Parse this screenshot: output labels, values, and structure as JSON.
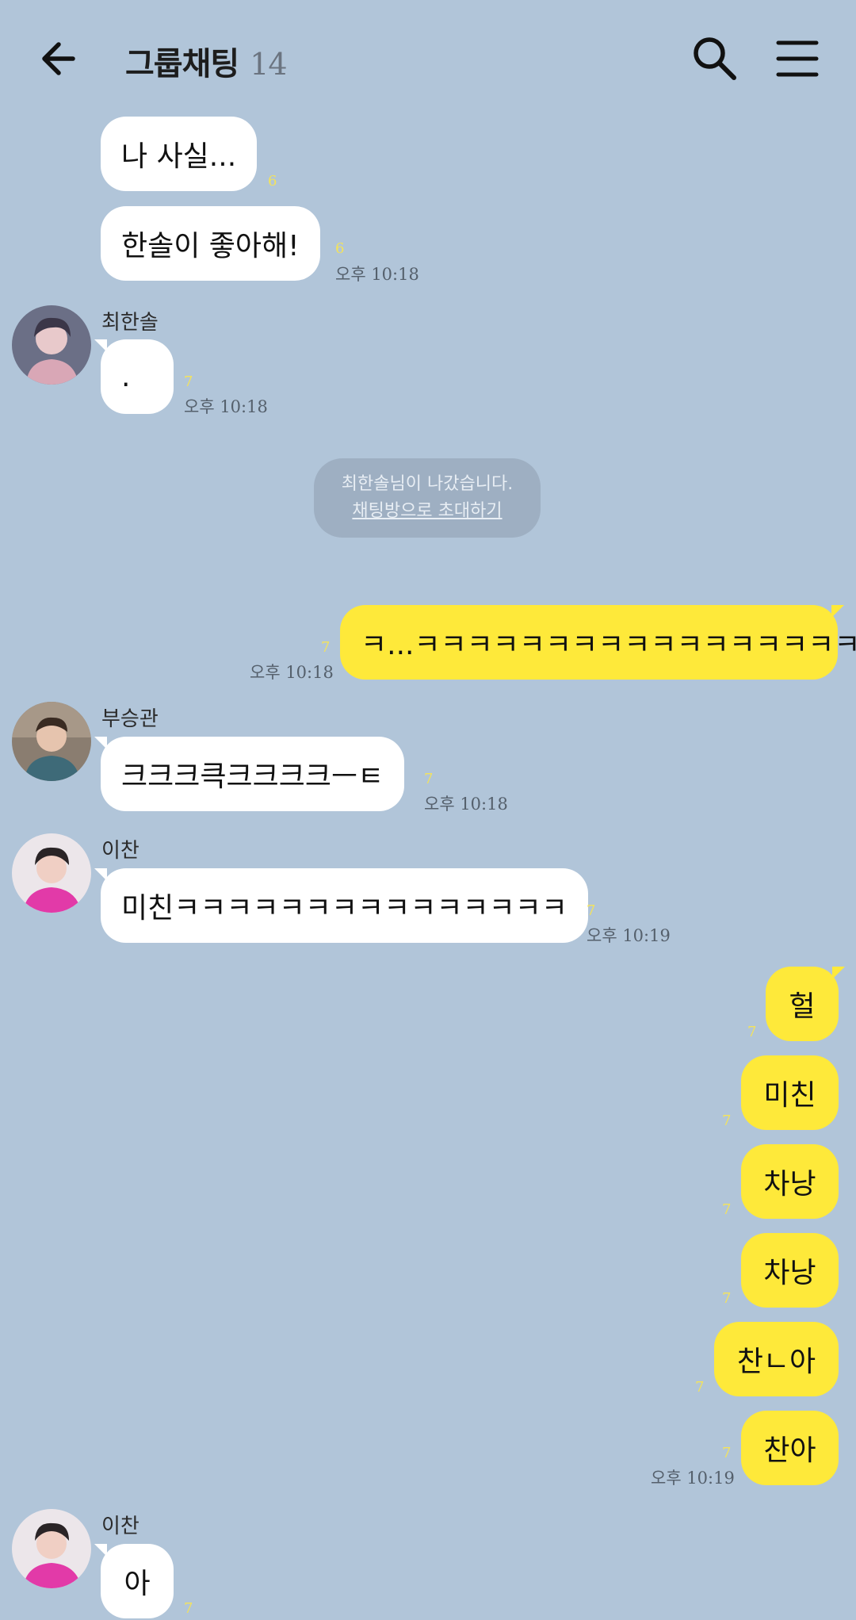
{
  "header": {
    "title": "그룹채팅",
    "member_count": "14"
  },
  "messages": {
    "m1": {
      "text": "나 사실...",
      "unread": "6"
    },
    "m2": {
      "text": "한솔이 좋아해!",
      "unread": "6",
      "time": "오후 10:18"
    },
    "m3": {
      "sender": "최한솔",
      "text": ".",
      "unread": "7",
      "time": "오후 10:18"
    },
    "notice": {
      "line1": "최한솔님이 나갔습니다.",
      "line2": "채팅방으로 초대하기"
    },
    "m4": {
      "text": "ㅋ...ㅋㅋㅋㅋㅋㅋㅋㅋㅋㅋㅋㅋㅋㅋㅋㅋㅋ",
      "unread": "7",
      "time": "오후 10:18"
    },
    "m5": {
      "sender": "부승관",
      "text": "크크크큭크크크크ㅡㅌ",
      "unread": "7",
      "time": "오후 10:18"
    },
    "m6": {
      "sender": "이찬",
      "text": "미친ㅋㅋㅋㅋㅋㅋㅋㅋㅋㅋㅋㅋㅋㅋㅋ",
      "unread": "7",
      "time": "오후 10:19"
    },
    "m7": {
      "text": "헐",
      "unread": "7"
    },
    "m8": {
      "text": "미친",
      "unread": "7"
    },
    "m9": {
      "text": "차낭",
      "unread": "7"
    },
    "m10": {
      "text": "차낭",
      "unread": "7"
    },
    "m11": {
      "text": "찬ㄴ아",
      "unread": "7"
    },
    "m12": {
      "text": "찬아",
      "unread": "7",
      "time": "오후 10:19"
    },
    "m13": {
      "sender": "이찬",
      "text": "아",
      "unread": "7"
    }
  },
  "colors": {
    "background": "#b1c5d9",
    "my_bubble": "#fee93a",
    "their_bubble": "#ffffff"
  },
  "icons": {
    "back": "arrow-left-icon",
    "search": "search-icon",
    "menu": "hamburger-menu-icon"
  }
}
